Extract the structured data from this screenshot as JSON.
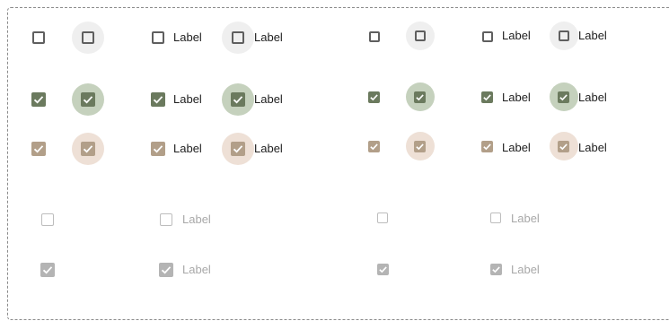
{
  "colors": {
    "unchecked_border": "#5f5f5f",
    "green_fill": "#6b7a5e",
    "green_halo": "#c5d1bd",
    "tan_fill": "#b29f89",
    "tan_halo": "#eee0d6",
    "hover_halo": "#efefef",
    "disabled_border": "#bdbdbd",
    "disabled_fill": "#b4b4b4"
  },
  "labels": {
    "r0c2": "Label",
    "r0c3": "Label",
    "r0c6": "Label",
    "r0c7": "Label",
    "r1c2": "Label",
    "r1c3": "Label",
    "r1c6": "Label",
    "r1c7": "Label",
    "r2c2": "Label",
    "r2c3": "Label",
    "r2c6": "Label",
    "r2c7": "Label",
    "r3c2": "Label",
    "r3c6": "Label",
    "r4c2": "Label",
    "r4c6": "Label"
  }
}
